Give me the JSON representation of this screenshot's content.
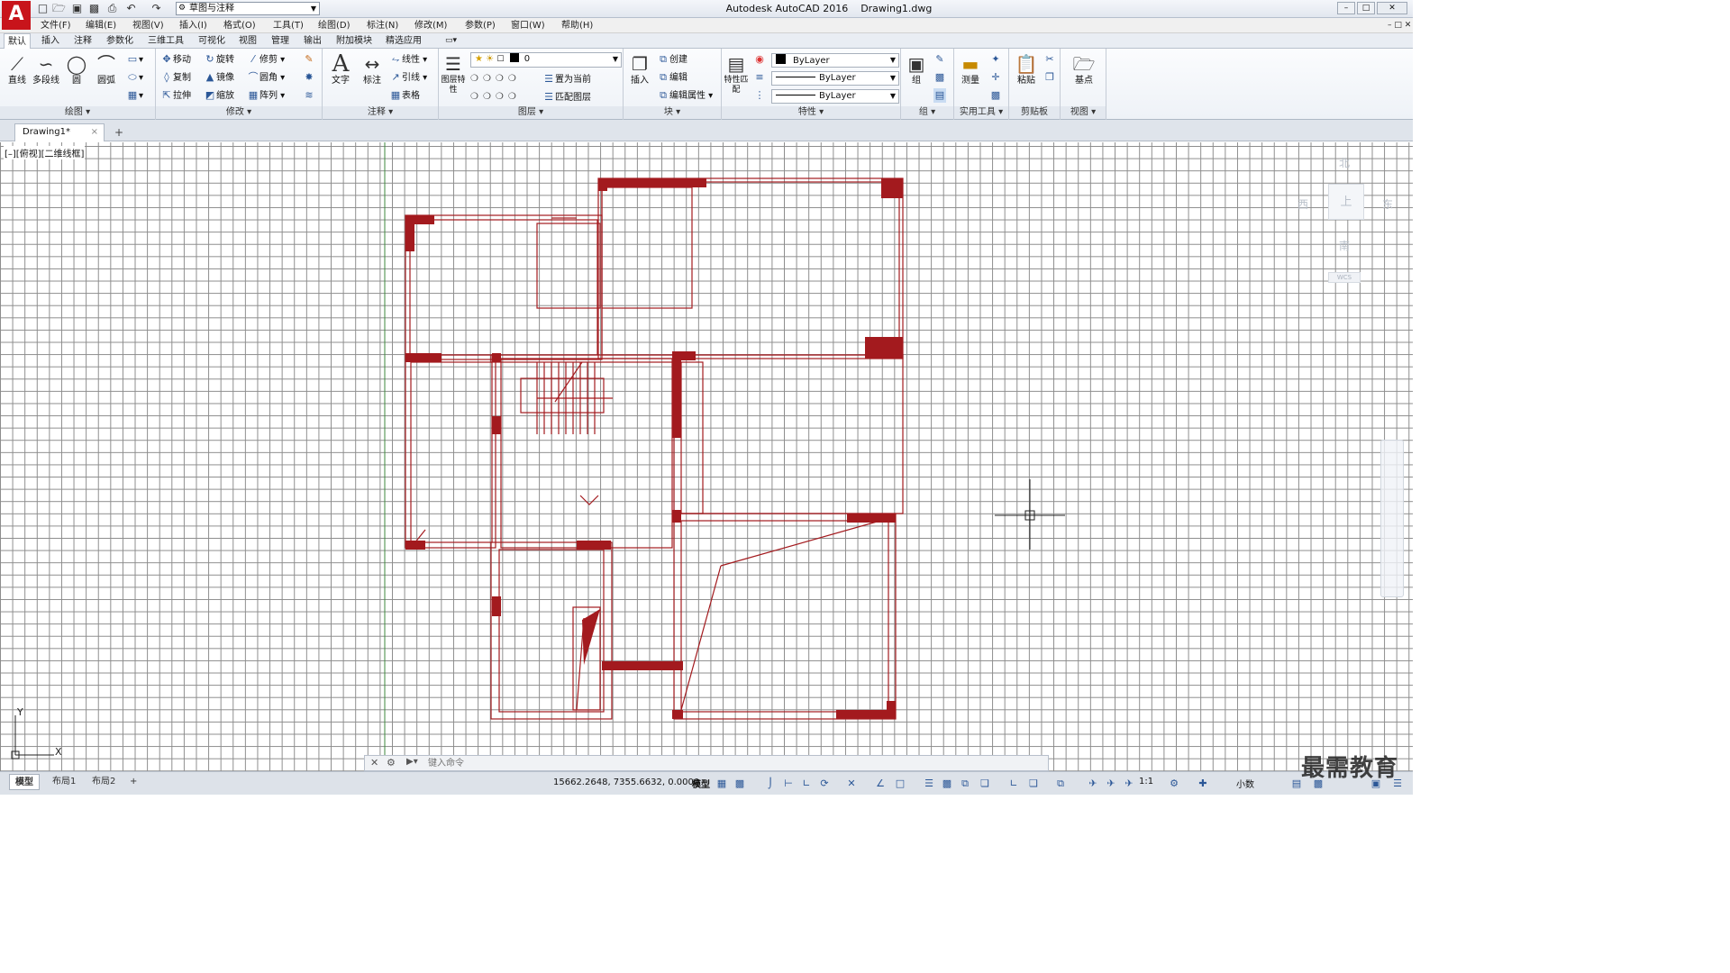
{
  "window": {
    "app_title": "Autodesk AutoCAD 2016",
    "file_name": "Drawing1.dwg",
    "logo": "A",
    "workspace": "草图与注释",
    "controls": [
      "–",
      "□",
      "✕"
    ]
  },
  "menu": [
    "文件(F)",
    "编辑(E)",
    "视图(V)",
    "插入(I)",
    "格式(O)",
    "工具(T)",
    "绘图(D)",
    "标注(N)",
    "修改(M)",
    "参数(P)",
    "窗口(W)",
    "帮助(H)"
  ],
  "ribbon_tabs": [
    "默认",
    "插入",
    "注释",
    "参数化",
    "三维工具",
    "可视化",
    "视图",
    "管理",
    "输出",
    "附加模块",
    "精选应用"
  ],
  "ribbon": {
    "draw": {
      "title": "绘图",
      "tools": [
        "直线",
        "多段线",
        "圆",
        "圆弧"
      ]
    },
    "modify": {
      "title": "修改",
      "tools": [
        "移动",
        "旋转",
        "修剪",
        "复制",
        "镜像",
        "圆角",
        "拉伸",
        "缩放",
        "阵列"
      ]
    },
    "annotation": {
      "title": "注释",
      "text": "文字",
      "dimension": "标注",
      "linear": "线性",
      "leader": "引线",
      "table": "表格"
    },
    "layers": {
      "title": "图层",
      "properties": "图层特性",
      "current_layer": "0",
      "set_current": "置为当前",
      "match_layer": "匹配图层",
      "layer_color": "#000000"
    },
    "block": {
      "title": "块",
      "insert": "插入",
      "create": "创建",
      "edit": "编辑",
      "edit_attributes": "编辑属性"
    },
    "properties": {
      "title": "特性",
      "match": "特性匹配",
      "color": "ByLayer",
      "linetype": "ByLayer",
      "lineweight": "ByLayer"
    },
    "groups": {
      "title": "组",
      "group": "组"
    },
    "utilities": {
      "title": "实用工具",
      "measure": "测量"
    },
    "clipboard": {
      "title": "剪贴板",
      "paste": "粘贴"
    },
    "view": {
      "title": "视图",
      "base": "基点"
    }
  },
  "document_tab": {
    "name": "Drawing1*",
    "close": "×",
    "new": "+"
  },
  "viewport": {
    "label": "[–][俯视][二维线框]",
    "viewcube": {
      "north": "北",
      "south": "南",
      "east": "东",
      "west": "西",
      "top": "上",
      "wcs": "WCS"
    },
    "drawing_color": "#a31a1e",
    "grid_color": "#8c8c8c"
  },
  "command": {
    "placeholder": "键入命令"
  },
  "layout_tabs": [
    "模型",
    "布局1",
    "布局2"
  ],
  "status": {
    "coordinates": "15662.2648, 7355.6632, 0.0000",
    "space": "模型",
    "scale": "1:1",
    "units": "小数"
  },
  "watermark": "最需教育"
}
